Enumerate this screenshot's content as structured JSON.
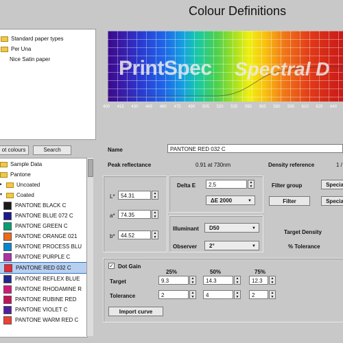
{
  "window": {
    "title": "Colour Definitions"
  },
  "library_tree": [
    {
      "label": "Standard paper types",
      "icon": "folder-icon"
    },
    {
      "label": "Per Una",
      "icon": "folder-icon"
    },
    {
      "label": "Nice Satin paper",
      "icon": "none"
    }
  ],
  "spectrum": {
    "brand_left": "PrintSpec",
    "brand_right": "Spectral D",
    "ticks": [
      "400",
      "415",
      "430",
      "445",
      "460",
      "475",
      "490",
      "505",
      "520",
      "535",
      "550",
      "565",
      "580",
      "595",
      "610",
      "625",
      "640"
    ]
  },
  "tabs": {
    "colours": "ot colours",
    "search": "Search"
  },
  "colour_tree": [
    {
      "label": "Sample Data",
      "type": "folder"
    },
    {
      "label": "Pantone",
      "type": "folder"
    },
    {
      "label": "Uncoated",
      "type": "folder"
    },
    {
      "label": "Coated",
      "type": "folder"
    },
    {
      "label": "PANTONE BLACK C",
      "type": "colour",
      "color": "#1a1a1a"
    },
    {
      "label": "PANTONE BLUE 072 C",
      "type": "colour",
      "color": "#1a1a8c"
    },
    {
      "label": "PANTONE GREEN C",
      "type": "colour",
      "color": "#00a070"
    },
    {
      "label": "PANTONE ORANGE 021",
      "type": "colour",
      "color": "#f06818"
    },
    {
      "label": "PANTONE PROCESS BLU",
      "type": "colour",
      "color": "#0088d0"
    },
    {
      "label": "PANTONE PURPLE C",
      "type": "colour",
      "color": "#b030a8"
    },
    {
      "label": "PANTONE RED 032 C",
      "type": "colour",
      "color": "#e82838",
      "selected": true
    },
    {
      "label": "PANTONE REFLEX BLUE",
      "type": "colour",
      "color": "#202890"
    },
    {
      "label": "PANTONE RHODAMINE R",
      "type": "colour",
      "color": "#d81878"
    },
    {
      "label": "PANTONE RUBINE RED",
      "type": "colour",
      "color": "#c8105a"
    },
    {
      "label": "PANTONE VIOLET C",
      "type": "colour",
      "color": "#5020a0"
    },
    {
      "label": "PANTONE WARM RED C",
      "type": "colour",
      "color": "#f04030"
    }
  ],
  "details": {
    "name_label": "Name",
    "name_value": "PANTONE RED 032 C",
    "peak_label": "Peak reflectance",
    "peak_value": "0.91 at 730nm",
    "density_ref_label": "Density reference",
    "density_ref_value": "1 /",
    "L_label": "L*",
    "L_value": "54.31",
    "a_label": "a*",
    "a_value": "74.35",
    "b_label": "b*",
    "b_value": "44.52",
    "deltae_label": "Delta E",
    "deltae_value": "2.5",
    "deltae_method": "ΔE 2000",
    "filter_group_label": "Filter group",
    "filter_button": "Filter",
    "special_1": "Specia",
    "special_2": "Specia",
    "illuminant_label": "Illuminant",
    "illuminant_value": "D50",
    "observer_label": "Observer",
    "observer_value": "2°",
    "target_density_label": "Target Density",
    "tolerance_pct_label": "% Tolerance"
  },
  "dot_gain": {
    "label": "Dot Gain",
    "checked": true,
    "col_25": "25%",
    "col_50": "50%",
    "col_75": "75%",
    "target_label": "Target",
    "target_25": "9.3",
    "target_50": "14.3",
    "target_75": "12.3",
    "tolerance_label": "Tolerance",
    "tol_25": "2",
    "tol_50": "4",
    "tol_75": "2",
    "import_button": "Import curve"
  }
}
